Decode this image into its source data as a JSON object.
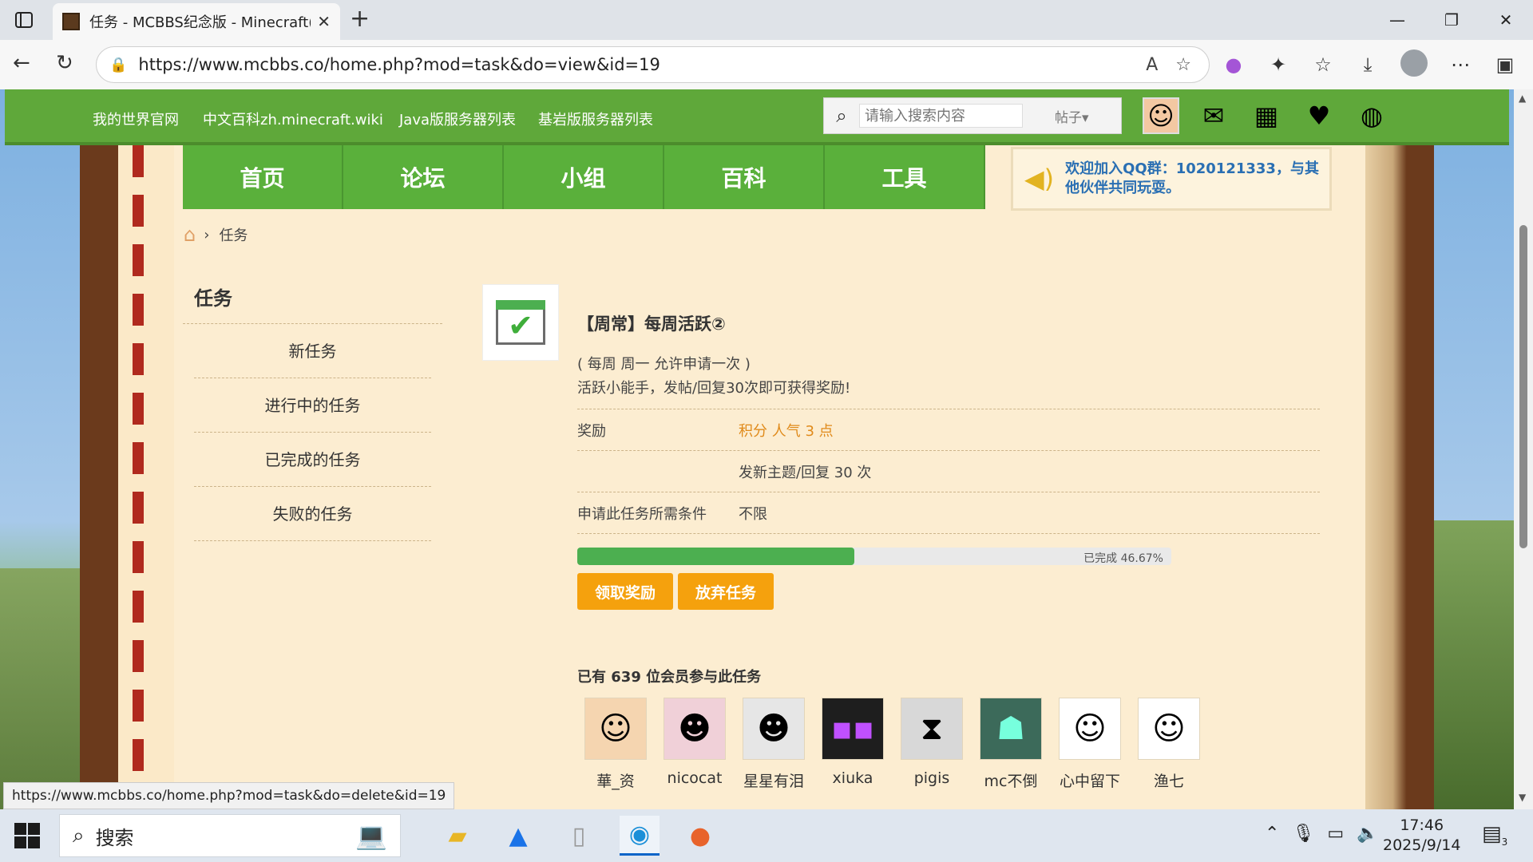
{
  "browser": {
    "tab_title": "任务 - MCBBS纪念版 - Minecraft(",
    "tab_close": "✕",
    "new_tab": "+",
    "url": "https://www.mcbbs.co/home.php?mod=task&do=view&id=19",
    "status_url": "https://www.mcbbs.co/home.php?mod=task&do=delete&id=19"
  },
  "site_topbar": {
    "links": [
      "我的世界官网",
      "中文百科zh.minecraft.wiki",
      "Java版服务器列表",
      "基岩版服务器列表"
    ],
    "search_placeholder": "请输入搜索内容",
    "search_type": "帖子▾"
  },
  "main_nav": [
    "首页",
    "论坛",
    "小组",
    "百科",
    "工具"
  ],
  "notice": "欢迎加入QQ群：1020121333，与其他伙伴共同玩耍。",
  "breadcrumb": {
    "current": "任务",
    "separator": "›"
  },
  "sidebar": {
    "heading": "任务",
    "items": [
      "新任务",
      "进行中的任务",
      "已完成的任务",
      "失败的任务"
    ]
  },
  "task": {
    "title": "【周常】每周活跃②",
    "period": "( 每周 周一 允许申请一次 )",
    "description": "活跃小能手，发帖/回复30次即可获得奖励!",
    "reward_label": "奖励",
    "reward_value": "积分 人气 3 点",
    "requirement_value": "发新主题/回复 30 次",
    "condition_label": "申请此任务所需条件",
    "condition_value": "不限",
    "progress_percent": 46.67,
    "progress_text": "已完成 46.67%",
    "claim_button": "领取奖励",
    "abandon_button": "放弃任务"
  },
  "members": {
    "title": "已有 639 位会员参与此任务",
    "list": [
      "華_资",
      "nicocat",
      "星星有泪",
      "xiuka",
      "pigis",
      "mc不倒",
      "心中留下",
      "渔七"
    ]
  },
  "taskbar": {
    "search_label": "搜索",
    "time": "17:46",
    "date": "2025/9/14",
    "notification_count": "3"
  }
}
